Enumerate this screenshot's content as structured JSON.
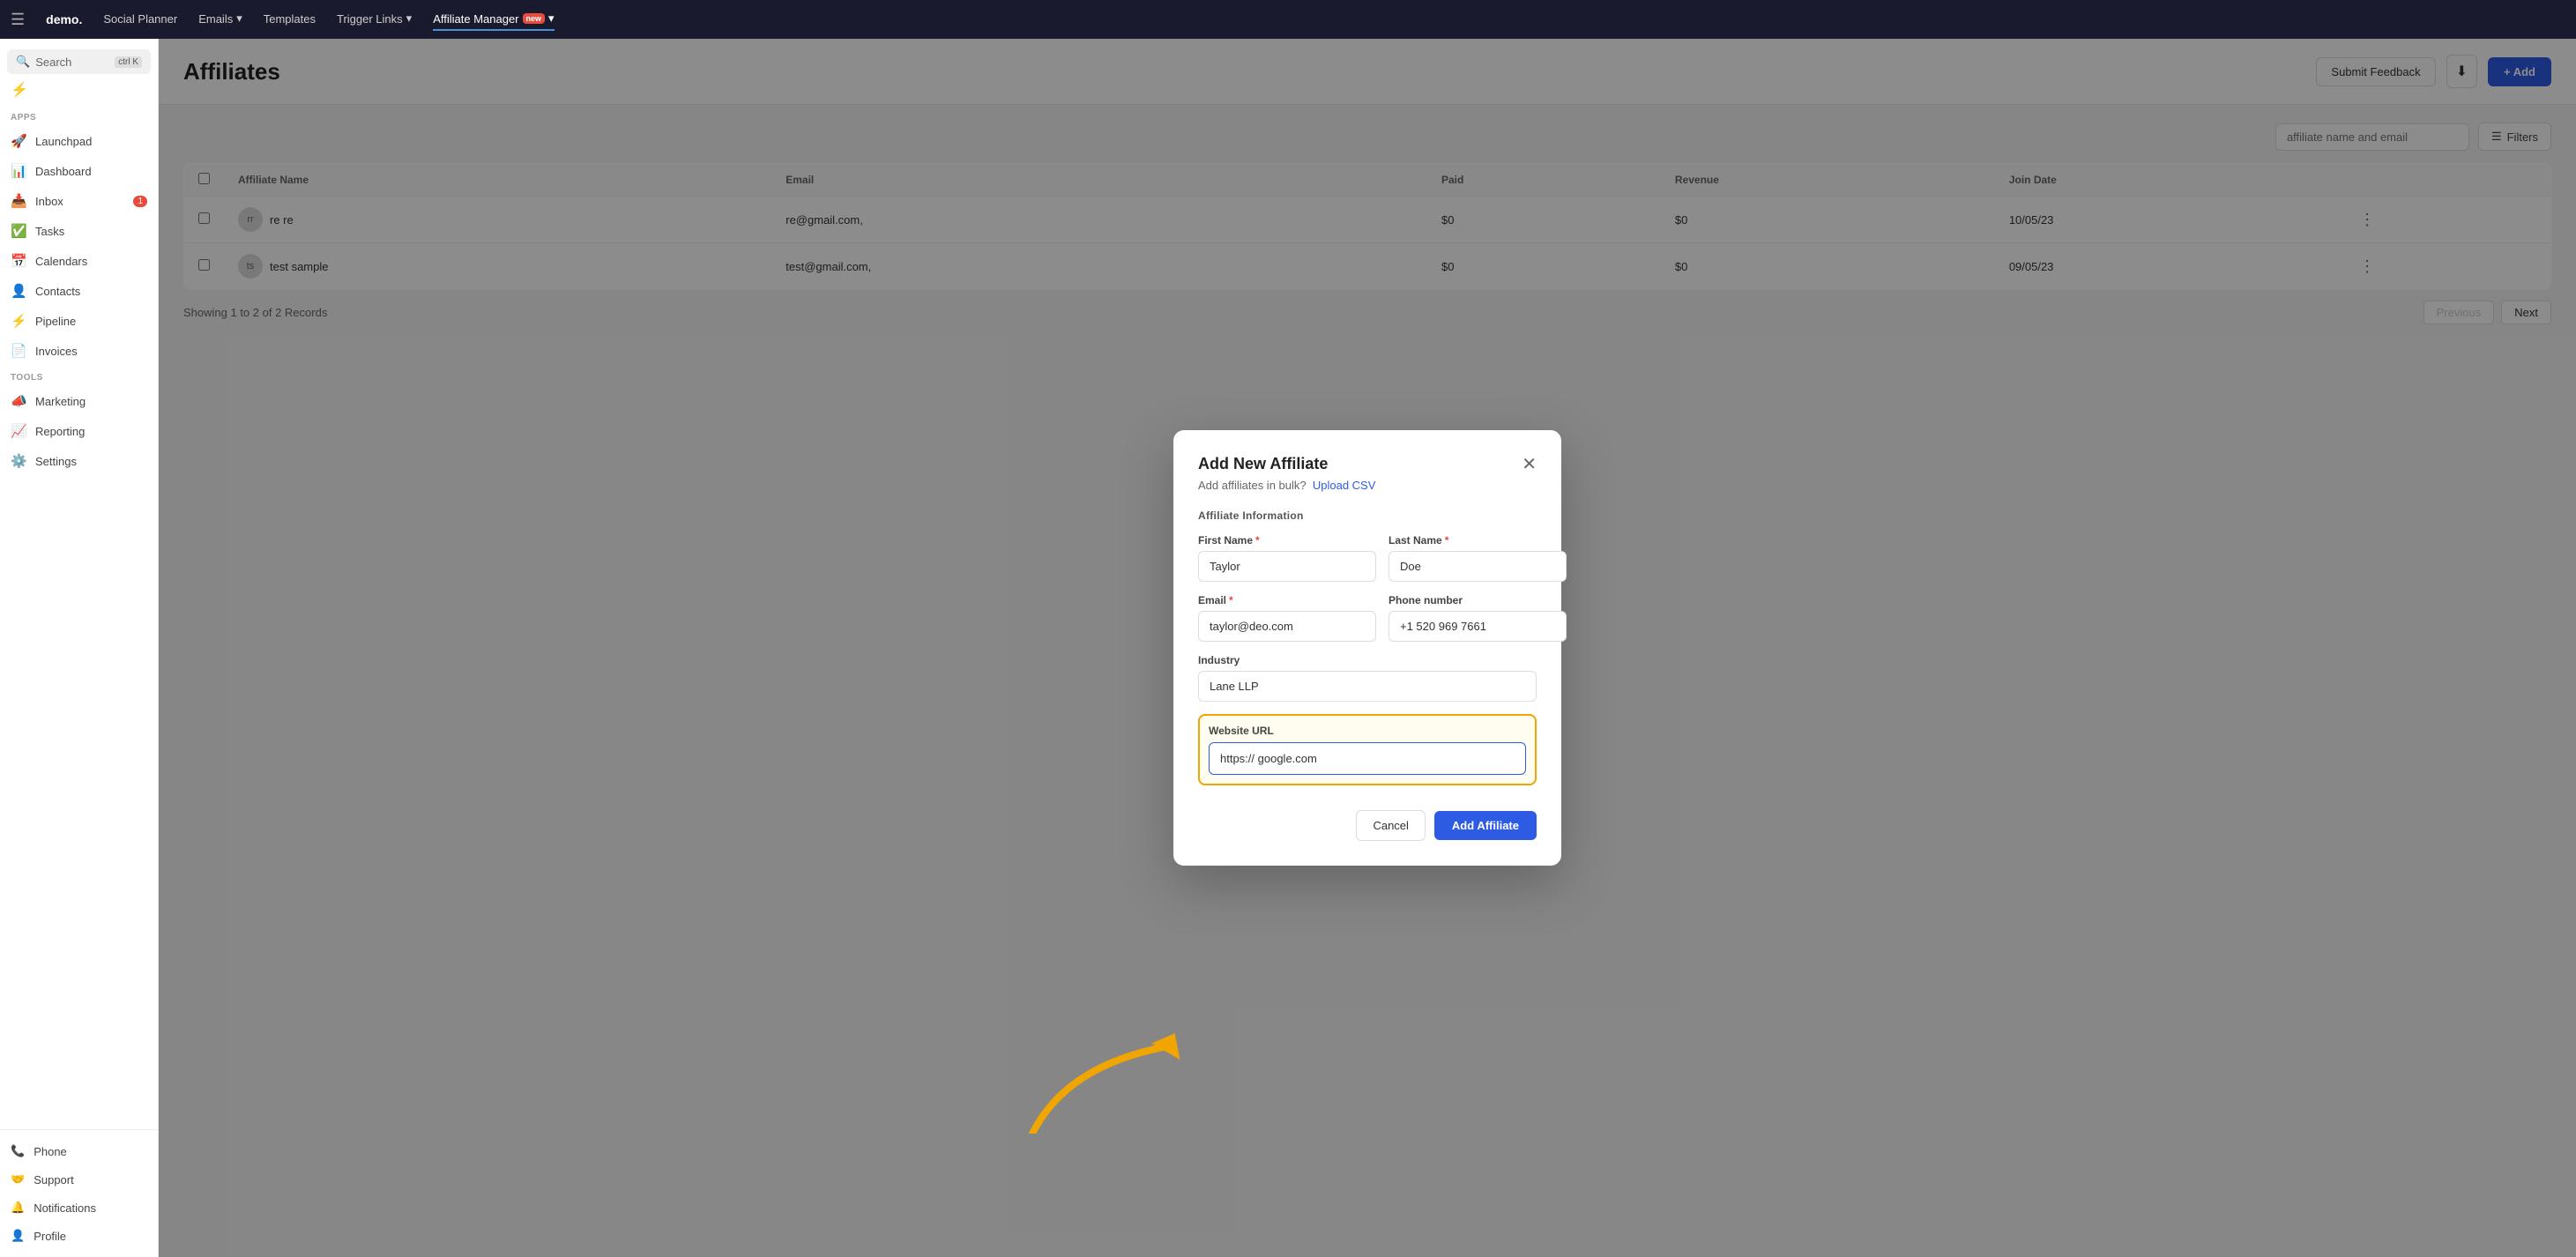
{
  "app": {
    "logo": "demo.",
    "nav_items": [
      {
        "label": "Social Planner",
        "active": false
      },
      {
        "label": "Emails",
        "active": false,
        "has_dropdown": true
      },
      {
        "label": "Templates",
        "active": false
      },
      {
        "label": "Trigger Links",
        "active": false,
        "has_dropdown": true
      },
      {
        "label": "Affiliate Manager",
        "active": true,
        "badge": "new"
      }
    ]
  },
  "sidebar": {
    "search": {
      "label": "Search",
      "shortcut": "ctrl K"
    },
    "apps_label": "Apps",
    "tools_label": "Tools",
    "items": [
      {
        "id": "launchpad",
        "icon": "🚀",
        "label": "Launchpad"
      },
      {
        "id": "dashboard",
        "icon": "📊",
        "label": "Dashboard"
      },
      {
        "id": "inbox",
        "icon": "📥",
        "label": "Inbox",
        "badge": "1"
      },
      {
        "id": "tasks",
        "icon": "✅",
        "label": "Tasks"
      },
      {
        "id": "calendars",
        "icon": "📅",
        "label": "Calendars"
      },
      {
        "id": "contacts",
        "icon": "👤",
        "label": "Contacts"
      },
      {
        "id": "pipeline",
        "icon": "⚡",
        "label": "Pipeline"
      },
      {
        "id": "invoices",
        "icon": "📄",
        "label": "Invoices"
      }
    ],
    "tool_items": [
      {
        "id": "marketing",
        "icon": "📣",
        "label": "Marketing"
      },
      {
        "id": "reporting",
        "icon": "📈",
        "label": "Reporting"
      },
      {
        "id": "settings",
        "icon": "⚙️",
        "label": "Settings"
      }
    ],
    "bottom_items": [
      {
        "id": "phone",
        "icon": "📞",
        "label": "Phone"
      },
      {
        "id": "support",
        "icon": "🤝",
        "label": "Support"
      },
      {
        "id": "notifications",
        "icon": "🔔",
        "label": "Notifications"
      },
      {
        "id": "profile",
        "icon": "👤",
        "label": "Profile"
      }
    ]
  },
  "page": {
    "title": "Affiliates",
    "header_actions": {
      "submit_feedback": "Submit Feedback",
      "add_button": "+ Add"
    }
  },
  "table": {
    "search_placeholder": "affiliate name and email",
    "filter_label": "Filters",
    "columns": [
      "",
      "Affiliate Name",
      "Email",
      "",
      "Paid",
      "Revenue",
      "Join Date",
      ""
    ],
    "rows": [
      {
        "name": "re re",
        "email": "re@gmail.com,",
        "paid": "$0",
        "revenue": "$0",
        "join_date": "10/05/23"
      },
      {
        "name": "test sample",
        "email": "test@gmail.com,",
        "paid": "$0",
        "revenue": "$0",
        "join_date": "09/05/23"
      }
    ],
    "footer": {
      "showing": "Showing 1 to 2 of 2 Records",
      "prev": "Previous",
      "next": "Next"
    }
  },
  "modal": {
    "title": "Add New Affiliate",
    "subtitle": "Add affiliates in bulk?",
    "upload_csv": "Upload CSV",
    "section_label": "Affiliate Information",
    "fields": {
      "first_name_label": "First Name",
      "first_name_value": "Taylor",
      "last_name_label": "Last Name",
      "last_name_value": "Doe",
      "email_label": "Email",
      "email_value": "taylor@deo.com",
      "phone_label": "Phone number",
      "phone_value": "+1 520 969 7661",
      "industry_label": "Industry",
      "industry_value": "Lane LLP",
      "website_url_label": "Website URL",
      "website_url_value": "https:// google.com"
    },
    "cancel_label": "Cancel",
    "add_affiliate_label": "Add Affiliate"
  }
}
